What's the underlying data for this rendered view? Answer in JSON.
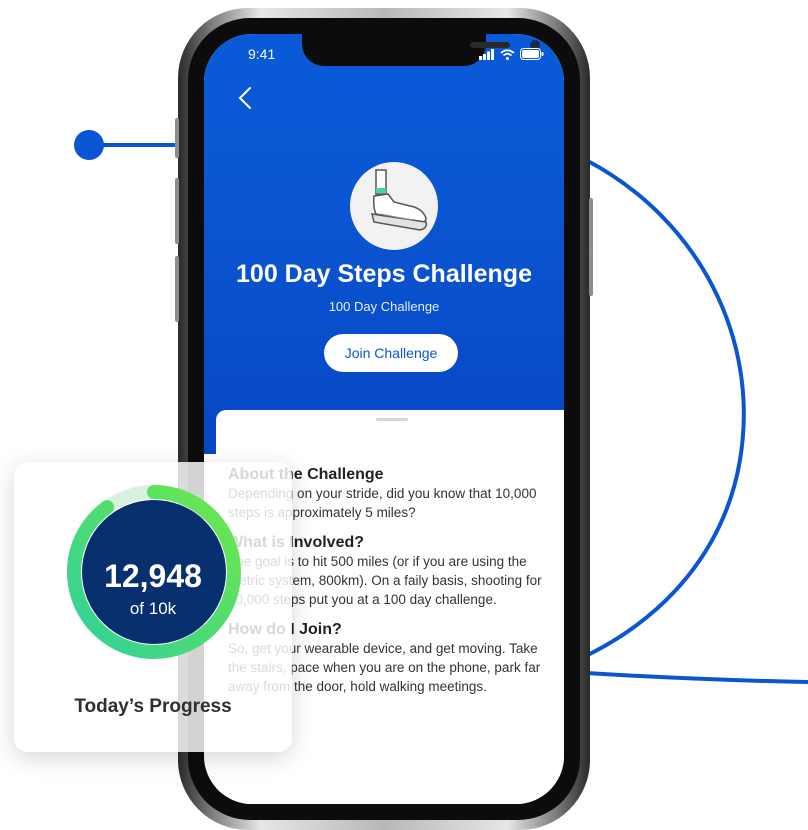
{
  "status": {
    "time": "9:41"
  },
  "challenge": {
    "title": "100 Day Steps Challenge",
    "subtitle": "100 Day Challenge",
    "join_label": "Join Challenge"
  },
  "sections": [
    {
      "title": "About the Challenge",
      "body": "Depending on your stride, did you know that 10,000 steps is approximately 5 miles?"
    },
    {
      "title": "What is Involved?",
      "body": "The goal is to hit 500 miles (or if you are using the metric system, 800km). On a faily basis, shooting for 10,000 steps put you at a 100 day challenge."
    },
    {
      "title": "How do I Join?",
      "body": "So, get your wearable device, and get moving. Take the stairs, pace when you are on the phone, park far away from the door, hold walking meetings."
    }
  ],
  "progress": {
    "steps": "12,948",
    "goal_text": "of 10k",
    "label": "Today’s Progress",
    "fraction": 0.9
  },
  "colors": {
    "brand_blue": "#0a56d2",
    "ring_green": "#3ed67a",
    "ring_center": "#08306f"
  },
  "icons": [
    "back-chevron-icon",
    "signal-icon",
    "wifi-icon",
    "battery-icon",
    "sneaker-icon"
  ]
}
